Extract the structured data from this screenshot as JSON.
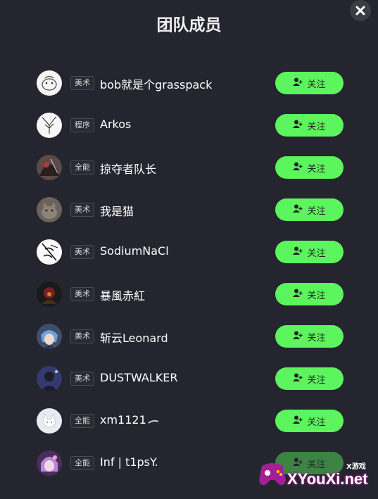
{
  "dialog": {
    "title": "团队成员",
    "close_icon": "close-icon"
  },
  "members": [
    {
      "role": "美术",
      "name": "bob就是个grasspack",
      "follow_label": "关注",
      "avatar": "sketch-face"
    },
    {
      "role": "程序",
      "name": "Arkos",
      "follow_label": "关注",
      "avatar": "tree"
    },
    {
      "role": "全能",
      "name": "掠夺者队长",
      "follow_label": "关注",
      "avatar": "dark-art"
    },
    {
      "role": "美术",
      "name": "我是猫",
      "follow_label": "关注",
      "avatar": "cat"
    },
    {
      "role": "美术",
      "name": "SodiumNaCl",
      "follow_label": "关注",
      "avatar": "ink-sketch"
    },
    {
      "role": "美术",
      "name": "暴風赤紅",
      "follow_label": "关注",
      "avatar": "red-figure"
    },
    {
      "role": "美术",
      "name": "斩云Leonard",
      "follow_label": "关注",
      "avatar": "blue-anime"
    },
    {
      "role": "美术",
      "name": "DUSTWALKER",
      "follow_label": "关注",
      "avatar": "night-figure"
    },
    {
      "role": "全能",
      "name": "xm1121",
      "follow_label": "关注",
      "avatar": "white-fox"
    },
    {
      "role": "全能",
      "name": "Inf | t1psY.",
      "follow_label": "关注",
      "avatar": "purple-anime"
    }
  ],
  "watermark": {
    "text": "XYouXi.net",
    "small_text": "X游戏",
    "brand_color": "#a32094"
  },
  "colors": {
    "background": "#25252f",
    "follow_button": "#5cf55e"
  }
}
